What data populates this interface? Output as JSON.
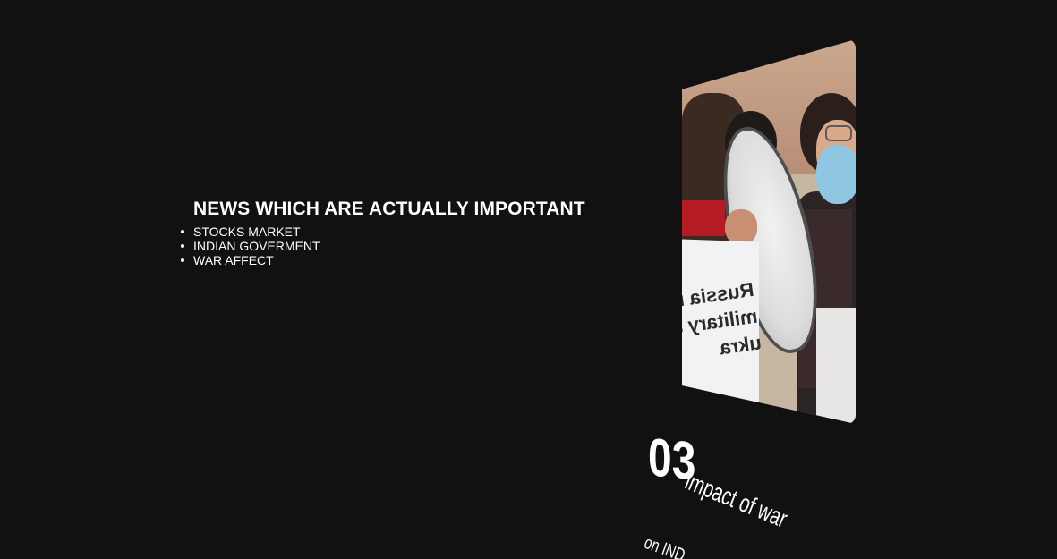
{
  "news": {
    "title": "NEWS WHICH ARE ACTUALLY IMPORTANT",
    "items": [
      {
        "label": "STOCKS MARKET"
      },
      {
        "label": "INDIAN GOVERMENT"
      },
      {
        "label": "WAR AFFECT"
      }
    ]
  },
  "card": {
    "image_icon": "protest-photo",
    "sign_line1": "Russia mu",
    "sign_line2": "military ag",
    "sign_line3": "ukra",
    "number": "03",
    "caption": "impact of war",
    "subcaption": "on IND"
  },
  "colors": {
    "background": "#111112",
    "text": "#ffffff"
  }
}
